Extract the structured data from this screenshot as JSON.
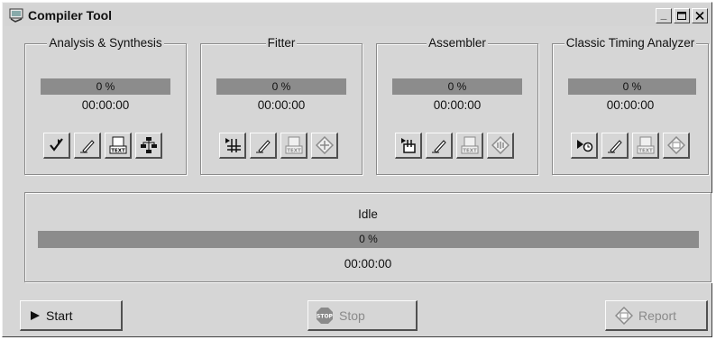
{
  "window": {
    "title": "Compiler Tool",
    "min_label": "_"
  },
  "modules": [
    {
      "title": "Analysis & Synthesis",
      "progress": "0 %",
      "time": "00:00:00"
    },
    {
      "title": "Fitter",
      "progress": "0 %",
      "time": "00:00:00"
    },
    {
      "title": "Assembler",
      "progress": "0 %",
      "time": "00:00:00"
    },
    {
      "title": "Classic Timing Analyzer",
      "progress": "0 %",
      "time": "00:00:00"
    }
  ],
  "overall": {
    "status": "Idle",
    "progress": "0 %",
    "time": "00:00:00"
  },
  "buttons": {
    "start": "Start",
    "stop": "Stop",
    "report": "Report",
    "stop_badge": "STOP",
    "text_badge": "TEXT"
  },
  "colors": {
    "face": "#d6d6d6",
    "progress_track": "#8c8c8c",
    "shadow": "#505050",
    "highlight": "#fbfbfb",
    "disabled_text": "#8a8a8a"
  }
}
